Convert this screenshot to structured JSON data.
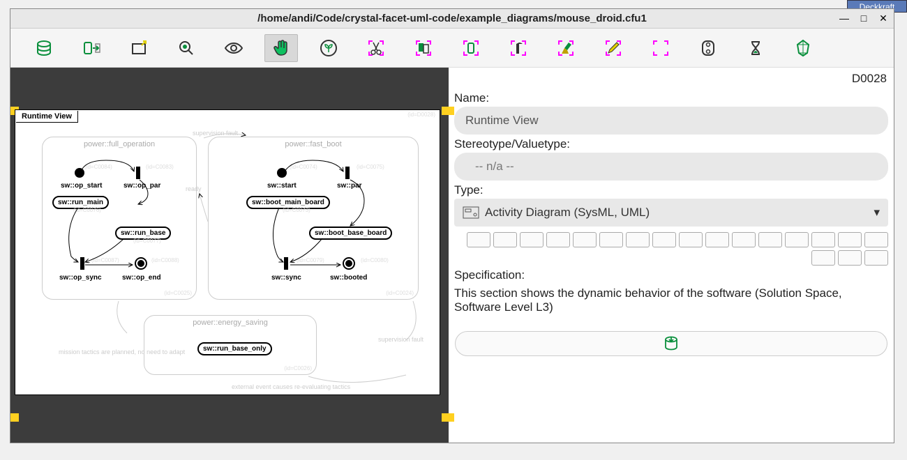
{
  "external": {
    "deckkraft_label": "Deckkraft"
  },
  "titlebar": {
    "path": "/home/andi/Code/crystal-facet-uml-code/example_diagrams/mouse_droid.cfu1",
    "minimize": "—",
    "maximize": "□",
    "close": "✕"
  },
  "toolbar": {
    "icons": [
      "database",
      "export",
      "new-window",
      "magnify",
      "eye",
      "hand",
      "sprout",
      "cut",
      "dup",
      "transfer",
      "reaper",
      "broom",
      "edit",
      "fullscreen",
      "save-remote",
      "hourglass",
      "crystal"
    ]
  },
  "canvas": {
    "title": "Runtime View",
    "diagram_id_faint": "(id=D0028)",
    "regions": {
      "full_op": {
        "label": "power::full_operation",
        "nodes": {
          "op_start": "sw::op_start",
          "op_par": "sw::op_par",
          "run_main": "sw::run_main",
          "run_base": "sw::run_base",
          "op_sync": "sw::op_sync",
          "op_end": "sw::op_end"
        },
        "ids": {
          "a": "(id=C0084)",
          "b": "(id=C0083)",
          "c": "(id=C0076)",
          "d": "(id=C0077)",
          "e": "(id=C0087)",
          "f": "(id=C0088)",
          "g": "(id=C0025)"
        }
      },
      "fast_boot": {
        "label": "power::fast_boot",
        "nodes": {
          "start": "sw::start",
          "par": "sw::par",
          "boot_main": "sw::boot_main_board",
          "boot_base": "sw::boot_base_board",
          "sync": "sw::sync",
          "booted": "sw::booted"
        },
        "ids": {
          "a": "(id=C0074)",
          "b": "(id=C0075)",
          "c": "(id=C0073)",
          "d": "(id=C0079)",
          "e": "(id=C0080)",
          "f": "(id=C0024)"
        }
      },
      "energy": {
        "label": "power::energy_saving",
        "nodes": {
          "run_base_only": "sw::run_base_only"
        },
        "id": "(id=C0026)"
      }
    },
    "edge_labels": {
      "supervision_fault": "supervision fault",
      "ready": "ready",
      "mission_tactics": "mission tactics are planned, no need to adapt",
      "supervision_fault2": "supervision fault",
      "external_event": "external event causes re-evaluating tactics"
    }
  },
  "side": {
    "diagram_id": "D0028",
    "name_label": "Name:",
    "name_value": "Runtime View",
    "stereo_label": "Stereotype/Valuetype:",
    "stereo_value": "-- n/a --",
    "type_label": "Type:",
    "type_value": "Activity Diagram (SysML, UML)",
    "spec_label": "Specification:",
    "spec_text": "This section shows the dynamic behavior of the software (Solution Space, Software Level L3)"
  }
}
